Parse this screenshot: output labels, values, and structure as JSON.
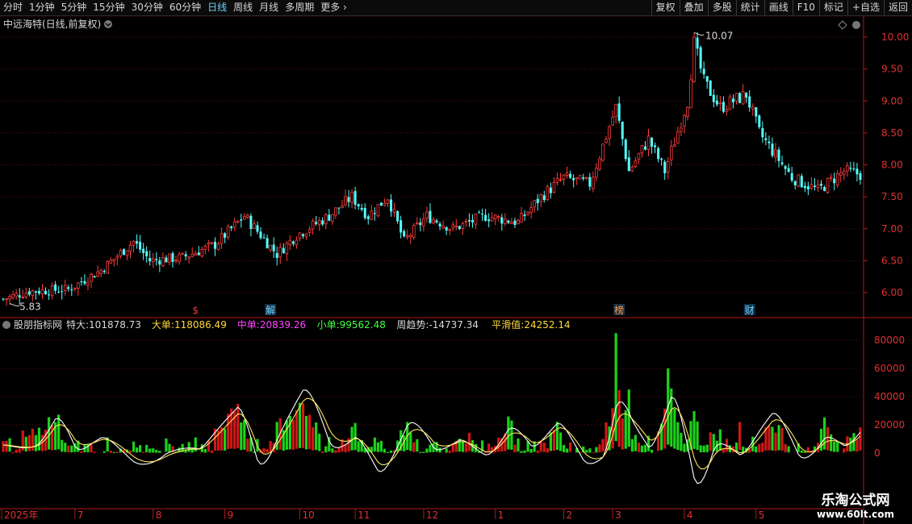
{
  "toolbar": {
    "periods": [
      "分时",
      "1分钟",
      "5分钟",
      "15分钟",
      "30分钟",
      "60分钟",
      "日线",
      "周线",
      "月线",
      "多周期",
      "更多"
    ],
    "active_period": "日线",
    "tools": [
      "复权",
      "叠加",
      "多股",
      "统计",
      "画线",
      "F10",
      "标记",
      "+自选",
      "返回"
    ]
  },
  "main_panel": {
    "title": "中远海特(日线,前复权)",
    "high_label": "10.07",
    "low_label": "5.83",
    "event_markers": [
      {
        "label": "$",
        "index": 59,
        "color": "#ff3030"
      },
      {
        "label": "解",
        "index": 82,
        "color": "#6fd3ff"
      },
      {
        "label": "榜",
        "index": 189,
        "color": "#ff9a40"
      },
      {
        "label": "财",
        "index": 229,
        "color": "#6fd3ff"
      }
    ],
    "price_ticks": [
      "10.00",
      "9.50",
      "9.00",
      "8.50",
      "8.00",
      "7.50",
      "7.00",
      "6.50",
      "6.00"
    ]
  },
  "indicator_panel": {
    "name": "股朋指标网",
    "items": [
      {
        "label": "特大:",
        "value": "101878.73",
        "color": "#d8d8d8"
      },
      {
        "label": "大单:",
        "value": "118086.49",
        "color": "#ffd93a"
      },
      {
        "label": "中单:",
        "value": "20839.26",
        "color": "#ff44ff"
      },
      {
        "label": "小单:",
        "value": "99562.48",
        "color": "#44ff44"
      },
      {
        "label": "周趋势:",
        "value": "-14737.34",
        "color": "#d8d8d8"
      },
      {
        "label": "平滑值:",
        "value": "24252.14",
        "color": "#ffd93a"
      }
    ],
    "value_ticks": [
      "80000",
      "60000",
      "40000",
      "20000",
      "0"
    ]
  },
  "time_axis": [
    {
      "label": "2025年",
      "index": 0
    },
    {
      "label": "7",
      "index": 22
    },
    {
      "label": "8",
      "index": 46
    },
    {
      "label": "9",
      "index": 68
    },
    {
      "label": "10",
      "index": 91
    },
    {
      "label": "11",
      "index": 108
    },
    {
      "label": "12",
      "index": 129
    },
    {
      "label": "1",
      "index": 151
    },
    {
      "label": "2",
      "index": 172
    },
    {
      "label": "3",
      "index": 187
    },
    {
      "label": "4",
      "index": 209
    },
    {
      "label": "5",
      "index": 231
    }
  ],
  "watermark": {
    "line1": "乐淘公式网",
    "line2": "www.60lt.com"
  },
  "chart_data": {
    "type": "candlestick",
    "count": 264,
    "price_range": [
      5.6,
      10.25
    ],
    "close_anchors": [
      [
        0,
        5.9
      ],
      [
        8,
        6.02
      ],
      [
        20,
        6.05
      ],
      [
        30,
        6.35
      ],
      [
        40,
        6.8
      ],
      [
        45,
        6.5
      ],
      [
        55,
        6.55
      ],
      [
        65,
        6.75
      ],
      [
        74,
        7.2
      ],
      [
        84,
        6.6
      ],
      [
        90,
        6.9
      ],
      [
        100,
        7.2
      ],
      [
        107,
        7.5
      ],
      [
        112,
        7.2
      ],
      [
        118,
        7.5
      ],
      [
        123,
        6.8
      ],
      [
        130,
        7.2
      ],
      [
        138,
        7.0
      ],
      [
        148,
        7.2
      ],
      [
        158,
        7.1
      ],
      [
        165,
        7.5
      ],
      [
        172,
        7.8
      ],
      [
        180,
        7.7
      ],
      [
        186,
        8.6
      ],
      [
        188,
        8.9
      ],
      [
        192,
        7.9
      ],
      [
        198,
        8.4
      ],
      [
        203,
        7.9
      ],
      [
        210,
        9.0
      ],
      [
        212,
        9.9
      ],
      [
        215,
        9.3
      ],
      [
        220,
        8.9
      ],
      [
        228,
        9.1
      ],
      [
        232,
        8.5
      ],
      [
        242,
        7.8
      ],
      [
        250,
        7.6
      ],
      [
        258,
        7.9
      ],
      [
        263,
        7.85
      ]
    ],
    "volume_range": [
      -40000,
      90000
    ],
    "volume_anchors": [
      [
        0,
        5000
      ],
      [
        10,
        12000
      ],
      [
        16,
        28000
      ],
      [
        22,
        -8000
      ],
      [
        30,
        6000
      ],
      [
        40,
        -2000
      ],
      [
        50,
        4000
      ],
      [
        60,
        -5000
      ],
      [
        72,
        35000
      ],
      [
        78,
        -8000
      ],
      [
        84,
        18000
      ],
      [
        92,
        38000
      ],
      [
        100,
        -6000
      ],
      [
        108,
        17000
      ],
      [
        115,
        -10000
      ],
      [
        124,
        20000
      ],
      [
        132,
        -8000
      ],
      [
        140,
        12000
      ],
      [
        148,
        4000
      ],
      [
        155,
        20000
      ],
      [
        162,
        -6000
      ],
      [
        170,
        18000
      ],
      [
        178,
        -4000
      ],
      [
        184,
        6000
      ],
      [
        188,
        45000
      ],
      [
        193,
        10000
      ],
      [
        198,
        -8000
      ],
      [
        205,
        40000
      ],
      [
        212,
        -25000
      ],
      [
        218,
        18000
      ],
      [
        226,
        -5000
      ],
      [
        236,
        22000
      ],
      [
        244,
        -5000
      ],
      [
        252,
        20000
      ],
      [
        258,
        4000
      ],
      [
        263,
        12000
      ]
    ],
    "volume_spikes": [
      [
        188,
        85000
      ],
      [
        204,
        60000
      ],
      [
        192,
        45000
      ],
      [
        226,
        22000
      ]
    ]
  }
}
